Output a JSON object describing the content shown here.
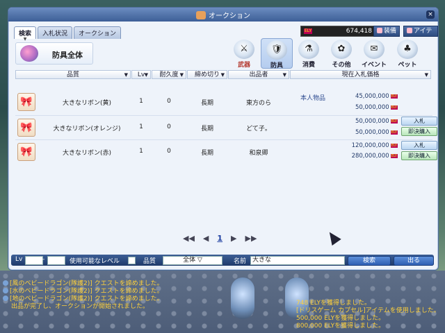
{
  "window": {
    "title": "オークション",
    "close": "×"
  },
  "tabs": [
    {
      "label": "検索",
      "caret": "▼"
    },
    {
      "label": "入札状況"
    },
    {
      "label": "オークション"
    }
  ],
  "money": {
    "icon": "ELY",
    "amount": "674,418"
  },
  "right_tabs": [
    {
      "label": "装備"
    },
    {
      "label": "アイテム"
    }
  ],
  "category": {
    "label": "防具全体"
  },
  "categories": [
    {
      "label": "武器",
      "icon": "sword-icon",
      "glyph": "⚔"
    },
    {
      "label": "防具",
      "icon": "armor-icon",
      "glyph": "🛡"
    },
    {
      "label": "消費",
      "icon": "potion-icon",
      "glyph": "⚗"
    },
    {
      "label": "その他",
      "icon": "misc-icon",
      "glyph": "✿"
    },
    {
      "label": "イベント",
      "icon": "event-icon",
      "glyph": "✉"
    },
    {
      "label": "ペット",
      "icon": "pet-icon",
      "glyph": "♣"
    }
  ],
  "headers": {
    "quality": "品質",
    "lv": "Lv",
    "durability": "耐久度",
    "deadline": "締め切り",
    "seller": "出品者",
    "price": "現在入札価格"
  },
  "rows": [
    {
      "name": "大きなリボン(黄)",
      "lv": "1",
      "dur": "0",
      "deadline": "長期",
      "seller": "東方のら",
      "owner_note": "本人物品",
      "price1": "45,000,000",
      "price2": "50,000,000",
      "color": "#f0a020"
    },
    {
      "name": "大きなリボン(オレンジ)",
      "lv": "1",
      "dur": "0",
      "deadline": "長期",
      "seller": "どて子。",
      "price1": "50,000,000",
      "price2": "50,000,000",
      "bid": "入札",
      "buy": "即決購入",
      "color": "#f06a10"
    },
    {
      "name": "大きなリボン(赤)",
      "lv": "1",
      "dur": "0",
      "deadline": "長期",
      "seller": "和泉卿",
      "price1": "120,000,000",
      "price2": "280,000,000",
      "bid": "入札",
      "buy": "即決購入",
      "color": "#e03040"
    }
  ],
  "pager": {
    "first": "◀◀",
    "prev": "◀",
    "page": "1",
    "next": "▶",
    "last": "▶▶"
  },
  "filter": {
    "lv_label": "Lv",
    "lv_min": "",
    "lv_max": "",
    "usable_label": "使用可能なレベル",
    "quality_label": "品質",
    "quality_value": "全体",
    "name_label": "名前",
    "name_value": "大きな",
    "search_button": "検索",
    "exit_button": "出る"
  },
  "chat_left": [
    "[風のベビードラゴン(隊護2)] クエストを諦めました。",
    "[水のベビードラゴン(隊護2)] クエストを諦めました。",
    "[地のベビードラゴン(隊護2)] クエストを諦めました。",
    "出品が完了し、オークションが開始されました。"
  ],
  "chat_right": [
    "748 ELYを獲得しました。",
    "[ドリスゲーム カプセル]アイテムを使用しました。",
    "500,000 ELYを獲得しました。",
    "800,000 ELYを獲得しました。"
  ]
}
